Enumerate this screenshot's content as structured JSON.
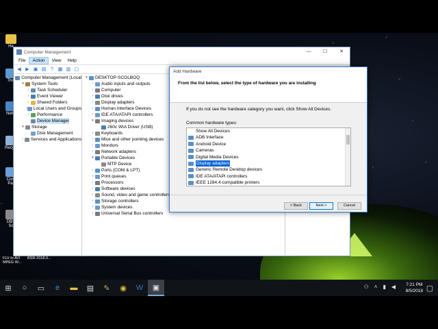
{
  "desktop": {
    "icons": [
      {
        "label": "He",
        "color": "#e8c34a"
      },
      {
        "label": "This",
        "color": "#5b9bd5"
      },
      {
        "label": "Netw",
        "color": "#4a86c5"
      },
      {
        "label": "Recycl",
        "color": "#8fb4d9"
      },
      {
        "label": "Com Par",
        "color": "#6aa0d8"
      },
      {
        "label": "DBS Sc",
        "color": "#8a8a8a"
      }
    ],
    "bottom_labels": [
      "FLV to AVI MPEG W...",
      "BSR-2018.0..."
    ]
  },
  "cm": {
    "title": "Computer Management",
    "menu": [
      "File",
      "Action",
      "View",
      "Help"
    ],
    "tree": [
      {
        "label": "Computer Management (Local",
        "level": 0,
        "ex": "",
        "color": "#6a8bb0"
      },
      {
        "label": "System Tools",
        "level": 1,
        "ex": "▾",
        "color": "#a87b3a"
      },
      {
        "label": "Task Scheduler",
        "level": 2,
        "ex": "›",
        "color": "#6a8bb0"
      },
      {
        "label": "Event Viewer",
        "level": 2,
        "ex": "›",
        "color": "#4a7fb0"
      },
      {
        "label": "Shared Folders",
        "level": 2,
        "ex": "›",
        "color": "#e0b84a"
      },
      {
        "label": "Local Users and Groups",
        "level": 2,
        "ex": "›",
        "color": "#6a9ad0"
      },
      {
        "label": "Performance",
        "level": 2,
        "ex": "›",
        "color": "#5aa05a"
      },
      {
        "label": "Device Manager",
        "level": 2,
        "ex": "",
        "color": "#6a8bb0",
        "sel": true
      },
      {
        "label": "Storage",
        "level": 1,
        "ex": "▾",
        "color": "#888"
      },
      {
        "label": "Disk Management",
        "level": 2,
        "ex": "",
        "color": "#7aa0c8"
      },
      {
        "label": "Services and Applications",
        "level": 1,
        "ex": "›",
        "color": "#888"
      }
    ],
    "devices": [
      {
        "label": "DESKTOP-SCGLBOQ",
        "level": 0,
        "ex": "▾"
      },
      {
        "label": "Audio inputs and outputs",
        "level": 1,
        "ex": "›"
      },
      {
        "label": "Computer",
        "level": 1,
        "ex": "›"
      },
      {
        "label": "Disk drives",
        "level": 1,
        "ex": "›"
      },
      {
        "label": "Display adapters",
        "level": 1,
        "ex": "›"
      },
      {
        "label": "Human Interface Devices",
        "level": 1,
        "ex": "›"
      },
      {
        "label": "IDE ATA/ATAPI controllers",
        "level": 1,
        "ex": "›"
      },
      {
        "label": "Imaging devices",
        "level": 1,
        "ex": "▾"
      },
      {
        "label": "260c WIA Driver (USB)",
        "level": 2,
        "ex": ""
      },
      {
        "label": "Keyboards",
        "level": 1,
        "ex": "›"
      },
      {
        "label": "Mice and other pointing devices",
        "level": 1,
        "ex": "›"
      },
      {
        "label": "Monitors",
        "level": 1,
        "ex": "›"
      },
      {
        "label": "Network adapters",
        "level": 1,
        "ex": "›"
      },
      {
        "label": "Portable Devices",
        "level": 1,
        "ex": "▾"
      },
      {
        "label": "MTP Device",
        "level": 2,
        "ex": ""
      },
      {
        "label": "Ports (COM & LPT)",
        "level": 1,
        "ex": "›"
      },
      {
        "label": "Print queues",
        "level": 1,
        "ex": "›"
      },
      {
        "label": "Processors",
        "level": 1,
        "ex": "›"
      },
      {
        "label": "Software devices",
        "level": 1,
        "ex": "›"
      },
      {
        "label": "Sound, video and game controllers",
        "level": 1,
        "ex": "›"
      },
      {
        "label": "Storage controllers",
        "level": 1,
        "ex": "›"
      },
      {
        "label": "System devices",
        "level": 1,
        "ex": "›"
      },
      {
        "label": "Universal Serial Bus controllers",
        "level": 1,
        "ex": "›"
      }
    ]
  },
  "ah": {
    "title": "Add Hardware",
    "header": "From the list below, select the type of hardware you are installing",
    "info": "If you do not see the hardware category you want, click Show All Devices.",
    "list_label": "Common hardware types:",
    "items": [
      "Show All Devices",
      "ADB Interface",
      "Android Device",
      "Cameras",
      "Digital Media Devices",
      "Display adapters",
      "Generic Remote Desktop devices",
      "IDE ATA/ATAPI controllers",
      "IEEE 1284.4 compatible printers"
    ],
    "selected": 5,
    "back": "< Back",
    "next": "Next >",
    "cancel": "Cancel"
  },
  "taskbar": {
    "time": "7:21 PM",
    "date": "8/5/2018"
  }
}
